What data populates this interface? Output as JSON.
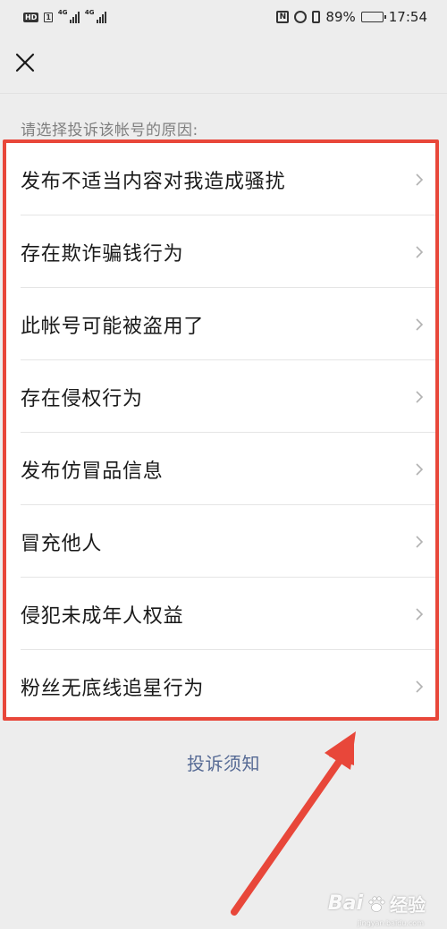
{
  "status_bar": {
    "left_badges": [
      "HD",
      "1"
    ],
    "network_labels": [
      "4G",
      "4G"
    ],
    "battery_level": 0.89,
    "battery_text": "89%",
    "time": "17:54",
    "icons": [
      "nfc-icon",
      "alarm-icon",
      "vibrate-icon",
      "battery-icon"
    ]
  },
  "header": {
    "close_icon": "close-icon"
  },
  "prompt": "请选择投诉该帐号的原因:",
  "reasons": [
    {
      "label": "发布不适当内容对我造成骚扰"
    },
    {
      "label": "存在欺诈骗钱行为"
    },
    {
      "label": "此帐号可能被盗用了"
    },
    {
      "label": "存在侵权行为"
    },
    {
      "label": "发布仿冒品信息"
    },
    {
      "label": "冒充他人"
    },
    {
      "label": "侵犯未成年人权益"
    },
    {
      "label": "粉丝无底线追星行为"
    }
  ],
  "notice_link": "投诉须知",
  "colors": {
    "highlight": "#e8473a",
    "link": "#576b95",
    "background": "#ededed"
  },
  "watermark": {
    "brand": "Bai",
    "sub": "经验",
    "url": "jingyan.baidu.com"
  }
}
